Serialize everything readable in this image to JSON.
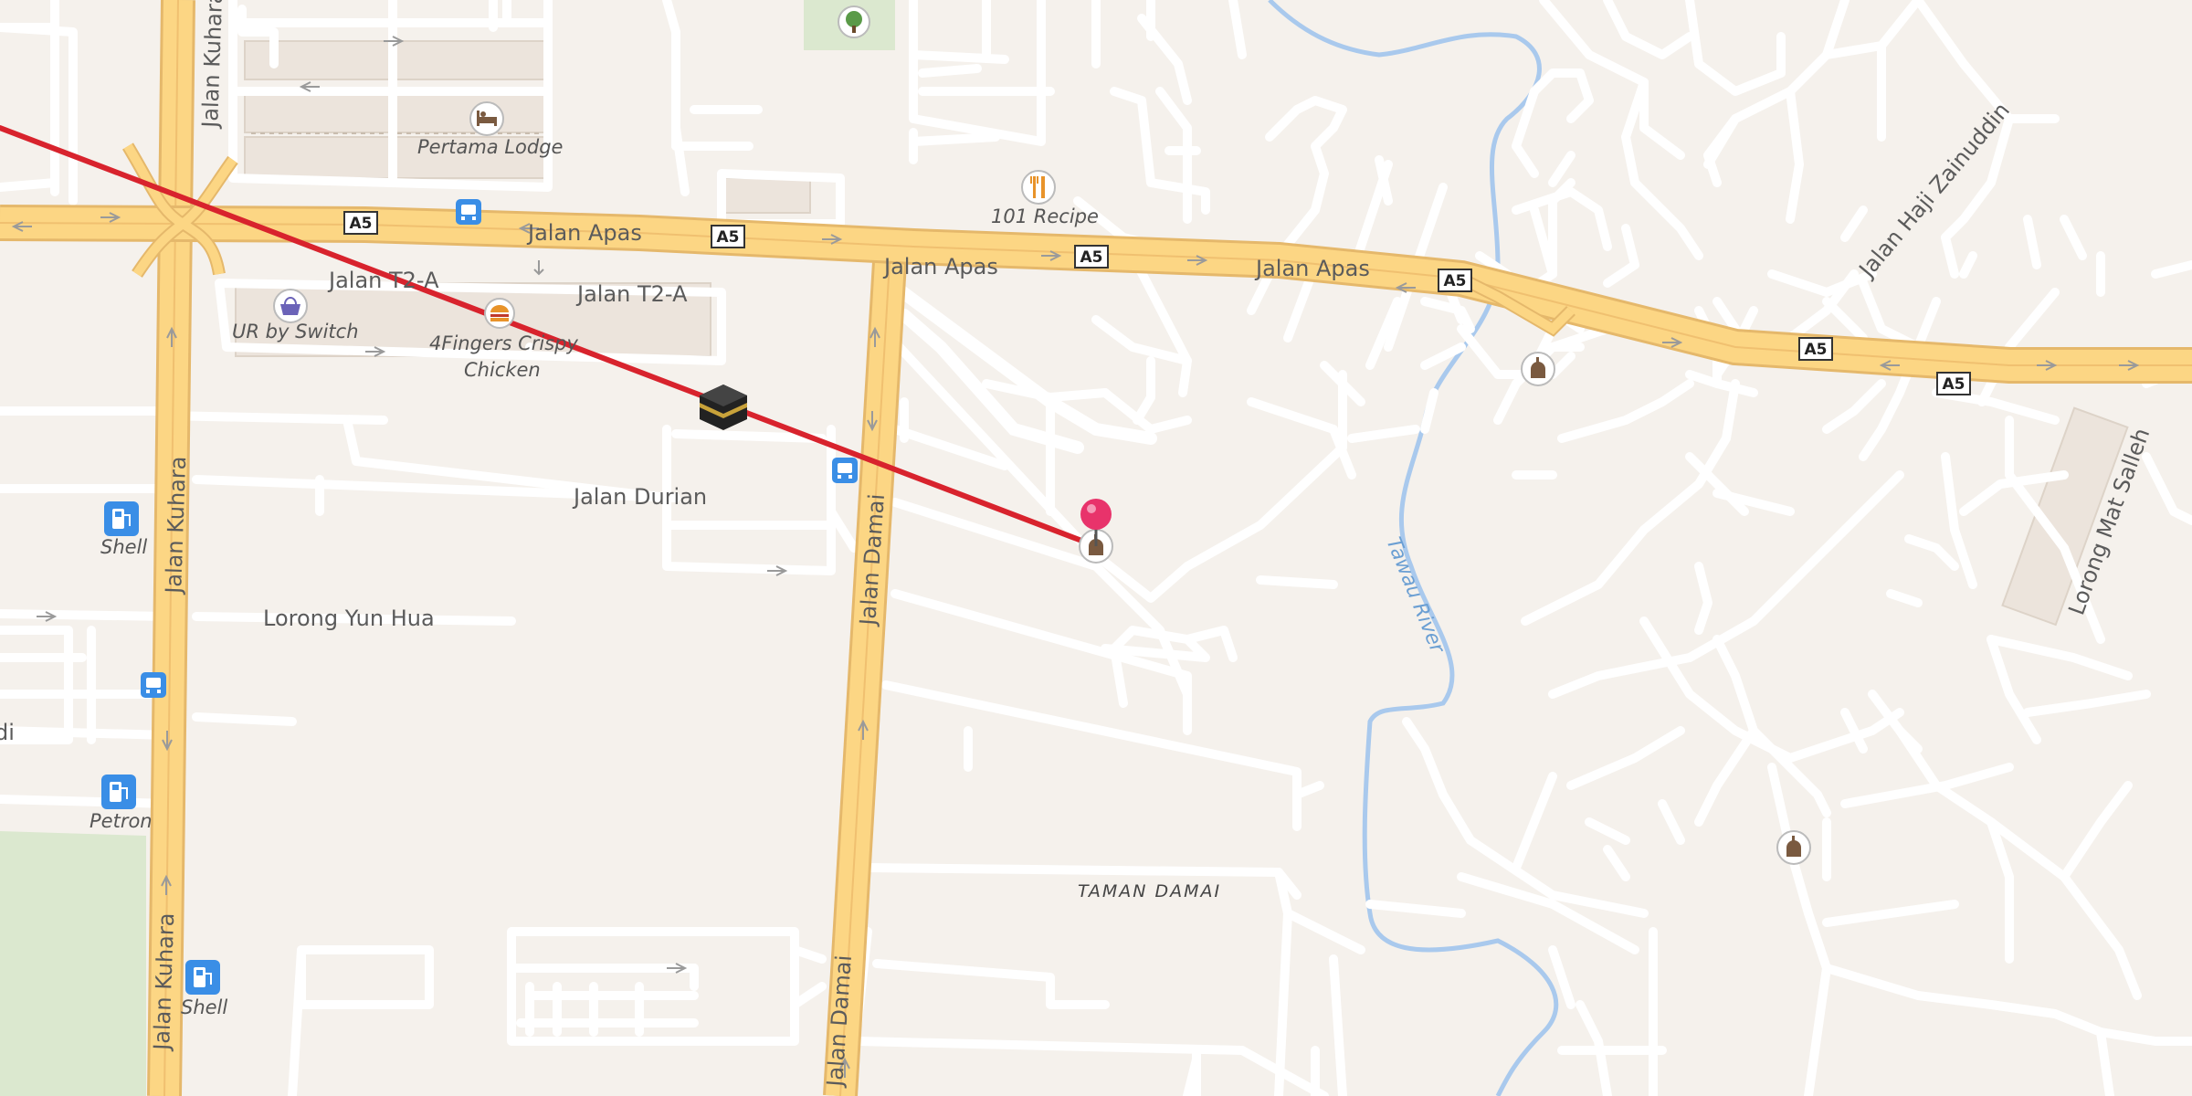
{
  "streets": {
    "kuhara_top": "Jalan Kuhara",
    "kuhara_mid": "Jalan Kuhara",
    "kuhara_bottom": "Jalan Kuhara",
    "apas_1": "Jalan Apas",
    "apas_2": "Jalan Apas",
    "apas_3": "Jalan Apas",
    "t2a_1": "Jalan T2-A",
    "t2a_2": "Jalan T2-A",
    "durian": "Jalan Durian",
    "yunhua": "Lorong Yun Hua",
    "damai_mid": "Jalan Damai",
    "damai_bottom": "Jalan Damai",
    "zainuddin": "Jalan Haji Zainuddin",
    "matsalleh": "Lorong Mat Salleh",
    "edge_fragment": "di"
  },
  "area_label": "TAMAN DAMAI",
  "river_label": "Tawau River",
  "route_shield": "A5",
  "pois": {
    "pertama": "Pertama Lodge",
    "recipe": "101 Recipe",
    "ur": "UR by Switch",
    "fingers_1": "4Fingers Crispy",
    "fingers_2": "Chicken",
    "shell_1": "Shell",
    "petron": "Petron",
    "shell_2": "Shell"
  },
  "icons": {
    "qibla": "kaaba-icon",
    "pin": "location-pin-icon",
    "mosque": "mosque-icon",
    "fuel": "fuel-station-icon",
    "bus": "bus-stop-icon",
    "hotel": "hotel-icon",
    "restaurant": "restaurant-icon",
    "shopping": "shopping-basket-icon",
    "fastfood": "fast-food-icon",
    "park": "park-tree-icon"
  },
  "colors": {
    "background": "#f5f1ec",
    "road_minor": "#ffffff",
    "road_major": "#fcd684",
    "road_casing": "#e5b86b",
    "qibla_line": "#d8232d",
    "river": "#a9c9ed",
    "park": "#dbe8cf",
    "pin": "#e8336b",
    "fuel": "#3a8ee6",
    "bus": "#3a8ee6"
  }
}
